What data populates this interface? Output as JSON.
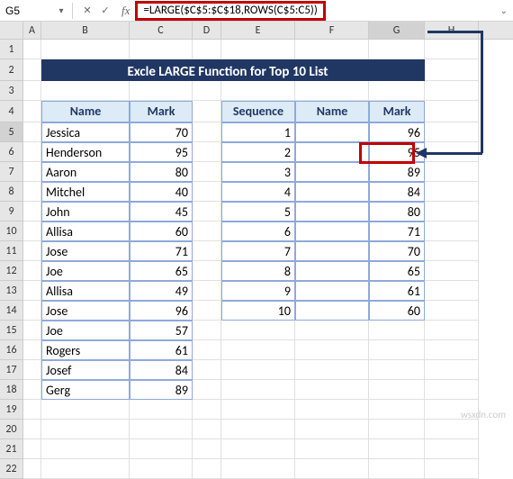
{
  "namebox": {
    "value": "G5"
  },
  "formula": {
    "value": "=LARGE($C$5:$C$18,ROWS(C$5:C5))"
  },
  "active_cell": {
    "ref": "G5",
    "value": "96"
  },
  "columns": [
    "A",
    "B",
    "C",
    "D",
    "E",
    "F",
    "G",
    "H"
  ],
  "title": "Excle LARGE Function for Top 10 List",
  "table1": {
    "headers": {
      "name": "Name",
      "mark": "Mark"
    },
    "rows": [
      {
        "name": "Jessica",
        "mark": 70
      },
      {
        "name": "Henderson",
        "mark": 95
      },
      {
        "name": "Aaron",
        "mark": 80
      },
      {
        "name": "Mitchel",
        "mark": 40
      },
      {
        "name": "John",
        "mark": 45
      },
      {
        "name": "Allisa",
        "mark": 60
      },
      {
        "name": "Jose",
        "mark": 71
      },
      {
        "name": "Joe",
        "mark": 65
      },
      {
        "name": "Allisa",
        "mark": 49
      },
      {
        "name": "Jose",
        "mark": 96
      },
      {
        "name": "Joe",
        "mark": 57
      },
      {
        "name": "Rogers",
        "mark": 61
      },
      {
        "name": "Josef",
        "mark": 84
      },
      {
        "name": "Gerg",
        "mark": 89
      }
    ]
  },
  "table2": {
    "headers": {
      "seq": "Sequence",
      "name": "Name",
      "mark": "Mark"
    },
    "rows": [
      {
        "seq": 1,
        "name": "",
        "mark": 96
      },
      {
        "seq": 2,
        "name": "",
        "mark": 95
      },
      {
        "seq": 3,
        "name": "",
        "mark": 89
      },
      {
        "seq": 4,
        "name": "",
        "mark": 84
      },
      {
        "seq": 5,
        "name": "",
        "mark": 80
      },
      {
        "seq": 6,
        "name": "",
        "mark": 71
      },
      {
        "seq": 7,
        "name": "",
        "mark": 70
      },
      {
        "seq": 8,
        "name": "",
        "mark": 65
      },
      {
        "seq": 9,
        "name": "",
        "mark": 61
      },
      {
        "seq": 10,
        "name": "",
        "mark": 60
      }
    ]
  },
  "watermark": "wsxdn.com",
  "icons": {
    "dd": "▾",
    "cancel": "✕",
    "confirm": "✓",
    "expand": "⌄",
    "fx": "fx"
  }
}
